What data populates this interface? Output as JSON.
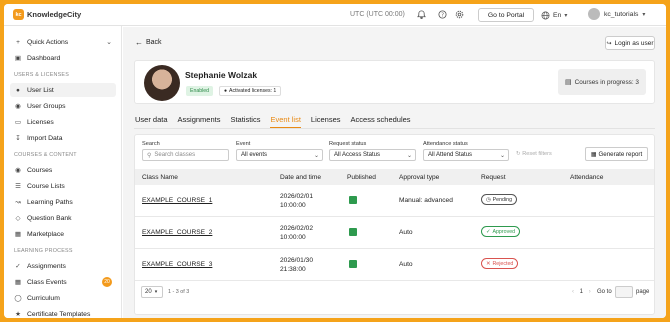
{
  "topbar": {
    "logo_mark": "kc",
    "brand": "KnowledgeCity",
    "timezone": "UTC (UTC 00:00)",
    "goto_portal": "Go to Portal",
    "language": "En",
    "username": "kc_tutorials"
  },
  "sidebar": {
    "quick_actions": "Quick Actions",
    "dashboard": "Dashboard",
    "sec_users": "USERS & LICENSES",
    "user_list": "User List",
    "user_groups": "User Groups",
    "licenses": "Licenses",
    "import_data": "Import Data",
    "sec_content": "COURSES & CONTENT",
    "courses": "Courses",
    "course_lists": "Course Lists",
    "learning_paths": "Learning Paths",
    "question_bank": "Question Bank",
    "marketplace": "Marketplace",
    "sec_learning": "LEARNING PROCESS",
    "assignments": "Assignments",
    "class_events": "Class Events",
    "class_events_badge": "20",
    "curriculum": "Curriculum",
    "certificate_templates": "Certificate Templates"
  },
  "main": {
    "back": "Back",
    "login_as_user": "Login as user",
    "profile": {
      "name": "Stephanie Wolzak",
      "status": "Enabled",
      "licenses": "Activated licenses: 1",
      "courses_in_progress": "Courses in progress: 3"
    },
    "tabs": [
      "User data",
      "Assignments",
      "Statistics",
      "Event list",
      "Licenses",
      "Access schedules"
    ],
    "active_tab": "Event list",
    "filters": {
      "search_label": "Search",
      "search_placeholder": "Search classes",
      "event_label": "Event",
      "event_value": "All events",
      "request_status_label": "Request status",
      "request_status_value": "All Access Status",
      "attendance_status_label": "Attendance status",
      "attendance_status_value": "All Attend Status",
      "reset": "Reset filters",
      "generate_report": "Generate report"
    },
    "table": {
      "headers": [
        "Class Name",
        "Date and time",
        "Published",
        "Approval type",
        "Request",
        "Attendance"
      ],
      "rows": [
        {
          "name": "EXAMPLE_COURSE_1",
          "date": "2026/02/01",
          "time": "10:00:00",
          "approval": "Manual: advanced",
          "request": "Pending"
        },
        {
          "name": "EXAMPLE_COURSE_2",
          "date": "2026/02/02",
          "time": "10:00:00",
          "approval": "Auto",
          "request": "Approved"
        },
        {
          "name": "EXAMPLE_COURSE_3",
          "date": "2026/01/30",
          "time": "21:38:00",
          "approval": "Auto",
          "request": "Rejected"
        }
      ]
    },
    "pagination": {
      "per_page": "20",
      "range": "1 - 3 of 3",
      "current_page": "1",
      "goto_label": "Go to",
      "page_label": "page"
    }
  }
}
